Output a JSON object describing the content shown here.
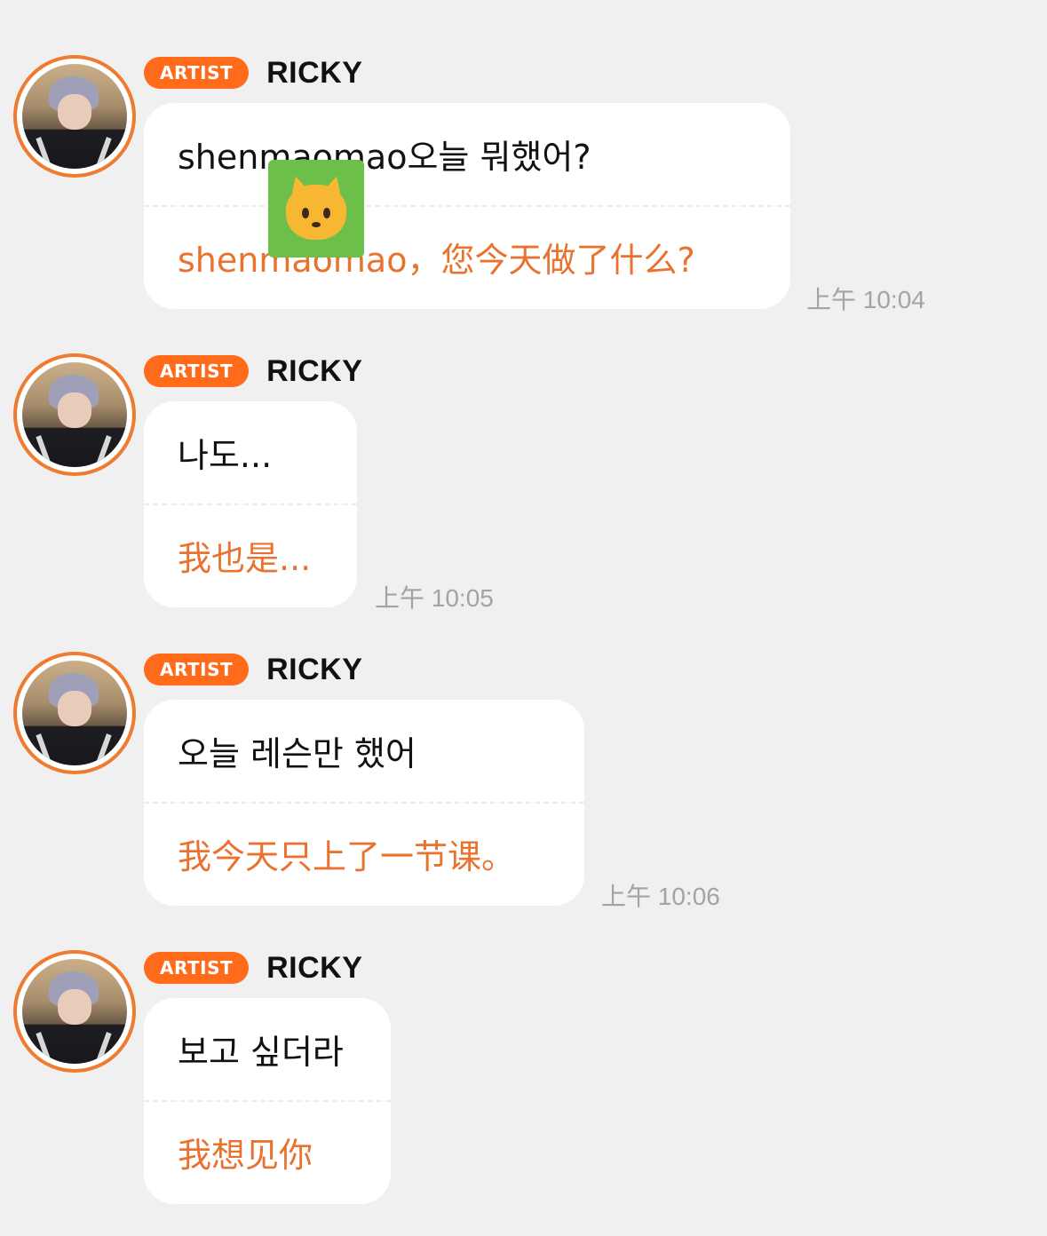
{
  "messages": [
    {
      "badge": "ARTIST",
      "sender": "RICKY",
      "text_ko": "shenmaomao오늘 뭐했어?",
      "text_zh": "shenmaomao，您今天做了什么?",
      "time": "上午 10:04"
    },
    {
      "badge": "ARTIST",
      "sender": "RICKY",
      "text_ko": "나도...",
      "text_zh": "我也是...",
      "time": "上午 10:05"
    },
    {
      "badge": "ARTIST",
      "sender": "RICKY",
      "text_ko": "오늘 레슨만 했어",
      "text_zh": "我今天只上了一节课。",
      "time": "上午 10:06"
    },
    {
      "badge": "ARTIST",
      "sender": "RICKY",
      "text_ko": "보고 싶더라",
      "text_zh": "我想见你",
      "time": ""
    }
  ],
  "overlay_sticker": "cat-face-emoji-icon",
  "colors": {
    "background": "#f0f0f0",
    "badge": "#ff6b1a",
    "avatar_ring": "#f07a2e",
    "translation_text": "#e8722e",
    "timestamp": "#a3a3a3"
  }
}
